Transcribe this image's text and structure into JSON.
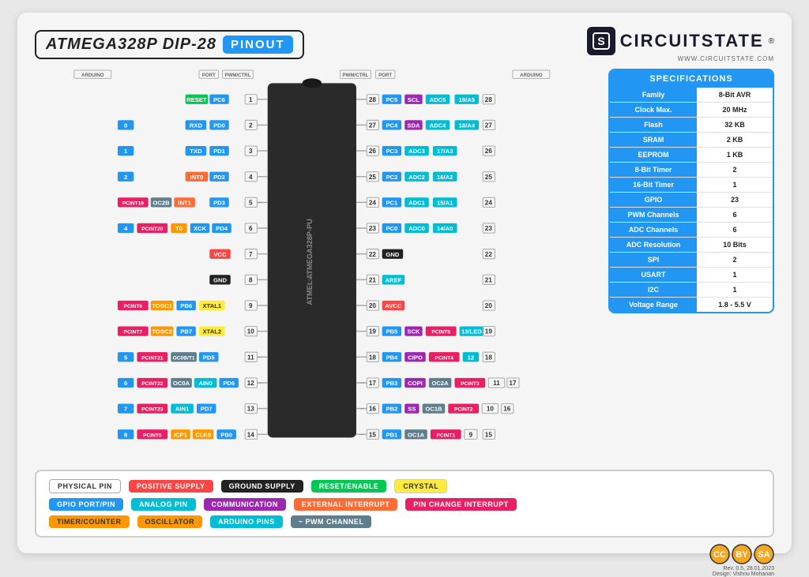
{
  "header": {
    "title_chip": "ATMEGA328P DIP-28",
    "title_pinout": "PINOUT",
    "logo_name": "CIRCUITSTATE",
    "logo_url": "WWW.CIRCUITSTATE.COM",
    "logo_symbol": "S"
  },
  "specs": {
    "header": "SPECIFICATIONS",
    "rows": [
      {
        "label": "Family",
        "value": "8-Bit AVR"
      },
      {
        "label": "Clock Max.",
        "value": "20 MHz"
      },
      {
        "label": "Flash",
        "value": "32 KB"
      },
      {
        "label": "SRAM",
        "value": "2 KB"
      },
      {
        "label": "EEPROM",
        "value": "1 KB"
      },
      {
        "label": "8-Bit Timer",
        "value": "2"
      },
      {
        "label": "16-Bit Timer",
        "value": "1"
      },
      {
        "label": "GPIO",
        "value": "23"
      },
      {
        "label": "PWM Channels",
        "value": "6"
      },
      {
        "label": "ADC Channels",
        "value": "6"
      },
      {
        "label": "ADC Resolution",
        "value": "10 Bits"
      },
      {
        "label": "SPI",
        "value": "2"
      },
      {
        "label": "USART",
        "value": "1"
      },
      {
        "label": "I2C",
        "value": "1"
      },
      {
        "label": "Voltage Range",
        "value": "1.8 - 5.5 V"
      }
    ]
  },
  "legend": {
    "rows": [
      [
        {
          "label": "PHYSICAL PIN",
          "class": "legend-physical"
        },
        {
          "label": "POSITIVE SUPPLY",
          "class": "legend-positive"
        },
        {
          "label": "GROUND SUPPLY",
          "class": "legend-ground"
        },
        {
          "label": "RESET/ENABLE",
          "class": "legend-reset"
        },
        {
          "label": "CRYSTAL",
          "class": "legend-crystal"
        }
      ],
      [
        {
          "label": "GPIO PORT/PIN",
          "class": "legend-gpio"
        },
        {
          "label": "ANALOG PIN",
          "class": "legend-analog"
        },
        {
          "label": "COMMUNICATION",
          "class": "legend-comm"
        },
        {
          "label": "EXTERNAL INTERRUPT",
          "class": "legend-extint"
        },
        {
          "label": "PIN CHANGE INTERRUPT",
          "class": "legend-pinchange"
        }
      ],
      [
        {
          "label": "TIMER/COUNTER",
          "class": "legend-timer"
        },
        {
          "label": "OSCILLATOR",
          "class": "legend-osc"
        },
        {
          "label": "ARDUINO PINS",
          "class": "legend-arduino"
        },
        {
          "label": "~ PWM CHANNEL",
          "class": "legend-pwm"
        }
      ]
    ]
  },
  "revision": {
    "text": "Rev. 0.5, 28.01.2023",
    "designer": "Design: Vishnu Mohanan"
  }
}
